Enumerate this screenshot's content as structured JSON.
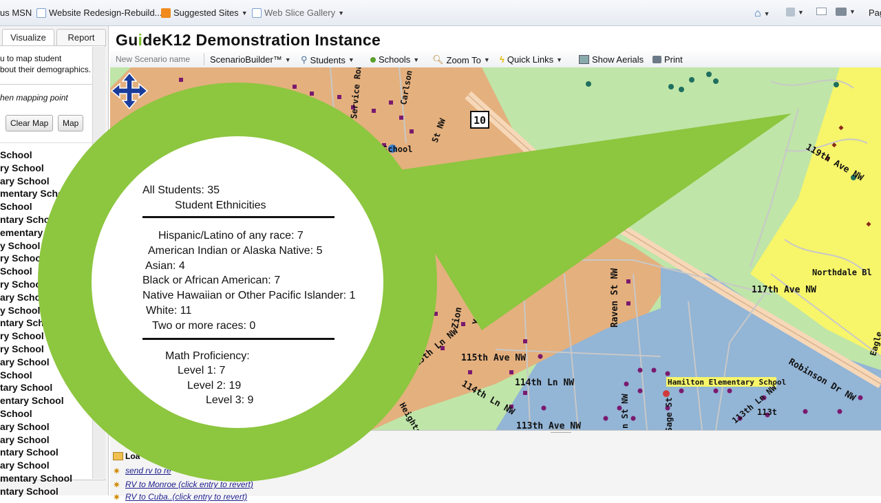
{
  "favorites_bar": {
    "items": [
      {
        "label": "us MSN"
      },
      {
        "label": "Website Redesign-Rebuild..."
      },
      {
        "label": "Suggested Sites"
      },
      {
        "label": "Web Slice Gallery"
      }
    ],
    "page_menu": "Pag"
  },
  "left_panel": {
    "tabs": [
      "Visualize",
      "Report"
    ],
    "description": "u to map student\nbout their demographics.",
    "hint": "hen mapping point",
    "clear_map_label": "Clear Map",
    "map_label": "Map",
    "school_list": [
      "School",
      "ry School",
      "ary School",
      "mentary School",
      "School",
      "ntary Schoo",
      "ementary S",
      "y School",
      "ry School",
      "School",
      "ry School",
      "ary Scho",
      "y School",
      "ntary Scho",
      "ry School",
      "ry School",
      "ary School",
      "School",
      "tary School",
      "entary School",
      "School",
      "ary School",
      "ary School",
      "ntary School",
      "ary School",
      "mentary School",
      "ntary School"
    ]
  },
  "app": {
    "title_parts": [
      "Gu",
      "i",
      "deK12 Demonstration Instance"
    ],
    "accent_color": "#7dbf2e"
  },
  "toolbar": {
    "scenario_placeholder": "New Scenario name",
    "items": [
      {
        "label": "ScenarioBuilder™",
        "icon": "none",
        "dropdown": true
      },
      {
        "label": "Students",
        "icon": "students-icon",
        "dropdown": true
      },
      {
        "label": "Schools",
        "icon": "pin-icon",
        "dropdown": true
      },
      {
        "label": "Zoom To",
        "icon": "magnifier-icon",
        "dropdown": true
      },
      {
        "label": "Quick Links",
        "icon": "lightning-icon",
        "dropdown": true
      },
      {
        "label": "Show Aerials",
        "icon": "aerial-icon",
        "dropdown": false
      },
      {
        "label": "Print",
        "icon": "printer-icon",
        "dropdown": false
      }
    ]
  },
  "map": {
    "labels": {
      "route": "10",
      "school_top": "ntar School",
      "hamilton": "Hamilton Elementary School",
      "ave_119": "119th Ave NW",
      "ave_117": "117th Ave NW",
      "ave_115": "115th Ave NW",
      "ln_114": "114th Ln NW",
      "ln_114b": "114th Ln NW",
      "ave_113": "113th Ave NW",
      "northdale": "Northdale Bl",
      "robinson": "Robinson Dr NW",
      "raven": "Raven St NW",
      "zion": "Zion",
      "yukon": "Yukon St",
      "ln_115": "115th Ln NW",
      "ln_113": "113th Ln NW",
      "sage": "Sage St",
      "eagle": "Eagle",
      "carlson": "Carlson",
      "service": "Service Road",
      "st_nw_top": "St NW",
      "heights": "Heights Dr",
      "ln_113b": "113t",
      "n_st": "n St NW"
    },
    "colors": {
      "park": "#bfe5a8",
      "zone_orange": "#e4b07e",
      "zone_blue": "#93b5d6",
      "zone_yellow": "#f7f56a",
      "student_dot": "#7a1a6e"
    }
  },
  "popup": {
    "all_students": "All Students: 35",
    "ethnicities_heading": "Student Ethnicities",
    "ethnicities": [
      "Hispanic/Latino of any race: 7",
      "American Indian or Alaska Native: 5",
      "Asian: 4",
      "Black or African American: 7",
      "Native Hawaiian or Other Pacific Islander: 1",
      "White: 11",
      "Two or more races: 0"
    ],
    "math_heading": "Math Proficiency:",
    "math_levels": [
      "Level 1: 7",
      "Level 2: 19",
      "Level 3: 9"
    ],
    "callout_color": "#8dc63f"
  },
  "bottom_panel": {
    "load_label": "Loa",
    "entries": [
      "send rv to re",
      "RV to Monroe (click entry to revert)",
      "RV to Cuba..(click entry to revert)"
    ]
  }
}
